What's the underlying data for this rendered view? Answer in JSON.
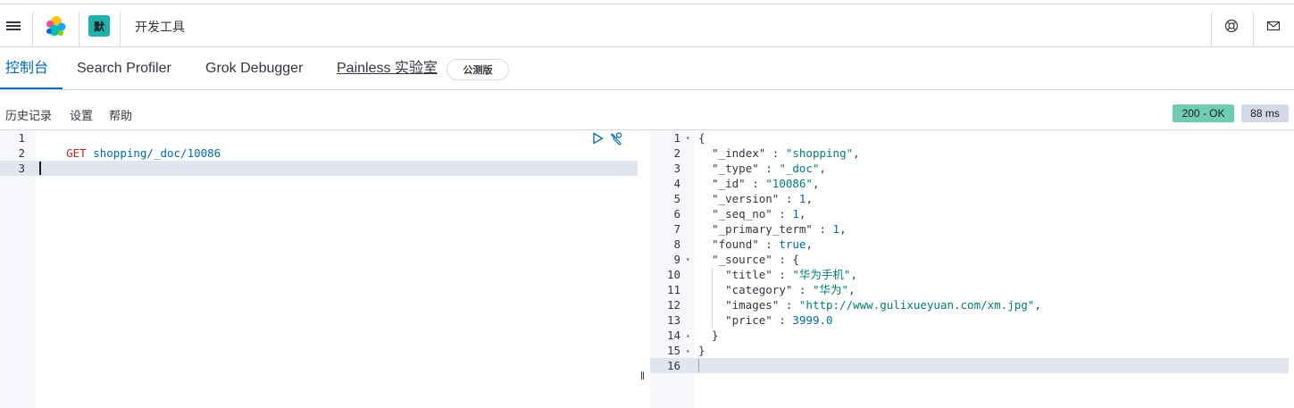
{
  "header": {
    "app_title": "开发工具",
    "space_initial": "默",
    "icons": [
      "menu-icon",
      "elastic-logo",
      "help-icon",
      "mail-icon"
    ]
  },
  "tabs": [
    {
      "label": "控制台",
      "active": true
    },
    {
      "label": "Search Profiler",
      "active": false
    },
    {
      "label": "Grok Debugger",
      "active": false
    },
    {
      "label": "Painless 实验室",
      "active": false
    }
  ],
  "beta_badge": "公测版",
  "toolbar": {
    "history": "历史记录",
    "settings": "设置",
    "help": "帮助",
    "status": "200 - OK",
    "time": "88 ms"
  },
  "request": {
    "method": "GET",
    "path": "shopping/_doc/10086",
    "line_numbers": [
      "1",
      "2",
      "3"
    ]
  },
  "response": {
    "line_numbers": [
      "1",
      "2",
      "3",
      "4",
      "5",
      "6",
      "7",
      "8",
      "9",
      "10",
      "11",
      "12",
      "13",
      "14",
      "15",
      "16"
    ],
    "index": "\"shopping\"",
    "type": "\"_doc\"",
    "id": "\"10086\"",
    "version": "1",
    "seq_no": "1",
    "primary_term": "1",
    "found": "true",
    "source": {
      "title": "\"华为手机\"",
      "category": "\"华为\"",
      "images": "\"http://www.gulixueyuan.com/xm.jpg\"",
      "price": "3999.0"
    }
  },
  "colors": {
    "accent": "#006bb4",
    "status_ok": "#6dccb1",
    "space_badge": "#20b2aa",
    "method": "#bd271e",
    "string": "#017d73"
  }
}
